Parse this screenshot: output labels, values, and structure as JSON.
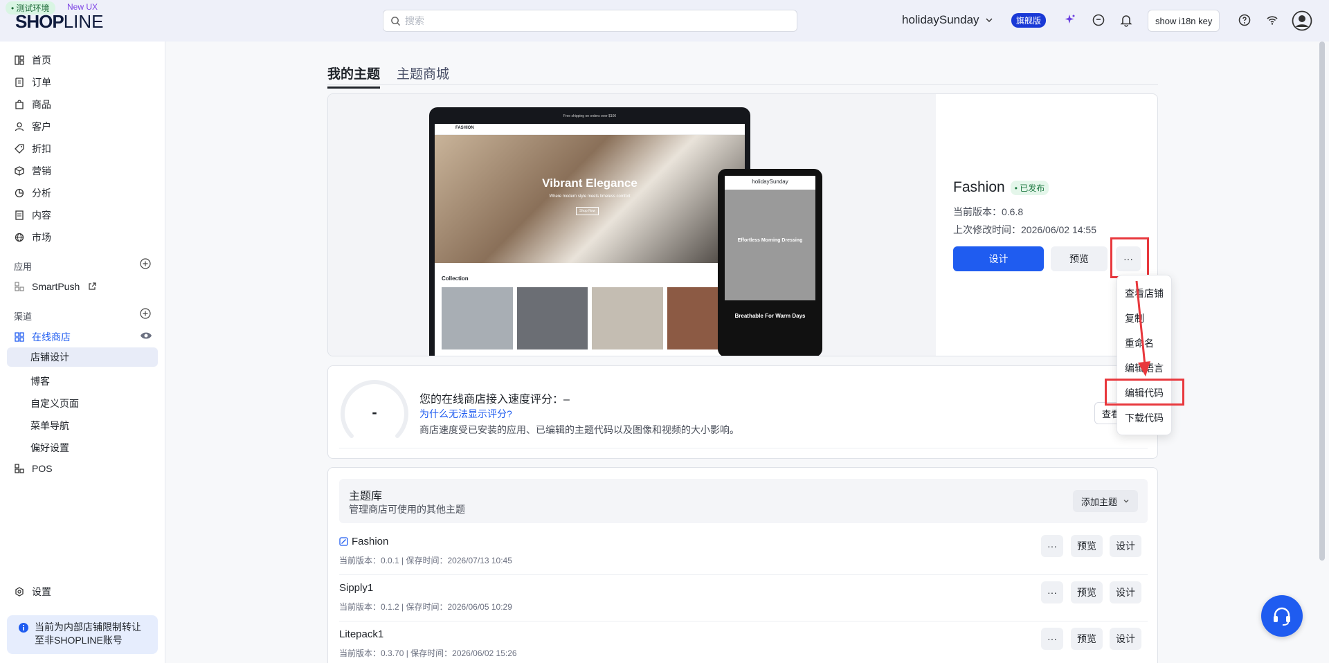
{
  "header": {
    "env_badge": "• 测试环境",
    "new_ux": "New UX",
    "logo_bold": "SHOP",
    "logo_light": "LINE",
    "search_placeholder": "搜索",
    "store_name": "holidaySunday",
    "plan_badge": "旗舰版",
    "i18n_button": "show i18n key",
    "icons": [
      "search-icon",
      "chevron-down-icon",
      "sparkle-icon",
      "chat-icon",
      "bell-icon",
      "help-icon",
      "wifi-icon",
      "user-icon"
    ]
  },
  "sidebar": {
    "items": [
      {
        "label": "首页",
        "icon": "home-icon"
      },
      {
        "label": "订单",
        "icon": "order-icon"
      },
      {
        "label": "商品",
        "icon": "bag-icon"
      },
      {
        "label": "客户",
        "icon": "person-icon"
      },
      {
        "label": "折扣",
        "icon": "tag-icon"
      },
      {
        "label": "营销",
        "icon": "marketing-icon"
      },
      {
        "label": "分析",
        "icon": "analytics-icon"
      },
      {
        "label": "内容",
        "icon": "content-icon"
      },
      {
        "label": "市场",
        "icon": "globe-icon"
      }
    ],
    "apps_title": "应用",
    "smartpush": "SmartPush",
    "channels_title": "渠道",
    "online_store": "在线商店",
    "sub_items": [
      "店铺设计",
      "博客",
      "自定义页面",
      "菜单导航",
      "偏好设置"
    ],
    "pos": "POS",
    "settings": "设置",
    "notice_line1": "当前为内部店铺限制转让",
    "notice_line2": "至非SHOPLINE账号"
  },
  "tabs": [
    "我的主题",
    "主题商城"
  ],
  "current_theme": {
    "name": "Fashion",
    "status": "• 已发布",
    "version": "当前版本：0.6.8",
    "modified": "上次修改时间：2026/06/02 14:55",
    "design_btn": "设计",
    "preview_btn": "预览",
    "more_btn": "···",
    "preview": {
      "banner": "Free shipping on orders over $100",
      "brand": "FASHION",
      "hero_title": "Vibrant Elegance",
      "hero_sub": "Where modern style meets timeless comfort",
      "shop_now": "Shop Now",
      "collection": "Collection",
      "phone_store": "holidaySunday",
      "phone_title": "Effortless Morning Dressing",
      "phone_dark": "Breathable For Warm Days"
    }
  },
  "dropdown": [
    "查看店铺",
    "复制",
    "重命名",
    "编辑语言",
    "编辑代码",
    "下载代码"
  ],
  "speed": {
    "gauge_value": "-",
    "title": "您的在线商店接入速度评分：–",
    "link": "为什么无法显示评分?",
    "desc": "商店速度受已安装的应用、已编辑的主题代码以及图像和视频的大小影响。",
    "view_btn": "查看"
  },
  "library": {
    "title": "主题库",
    "subtitle": "管理商店可使用的其他主题",
    "add_btn": "添加主题",
    "rows": [
      {
        "name": "Fashion",
        "meta": "当前版本：0.0.1 | 保存时间：2026/07/13 10:45",
        "more": "···",
        "preview": "预览",
        "design": "设计"
      },
      {
        "name": "Sipply1",
        "meta": "当前版本：0.1.2 | 保存时间：2026/06/05 10:29",
        "more": "···",
        "preview": "预览",
        "design": "设计"
      },
      {
        "name": "Litepack1",
        "meta": "当前版本：0.3.70 | 保存时间：2026/06/02 15:26",
        "more": "···",
        "preview": "预览",
        "design": "设计"
      }
    ]
  },
  "colors": {
    "primary": "#1f5cf0",
    "highlight": "#e8383d",
    "published": "#1f7a42"
  }
}
